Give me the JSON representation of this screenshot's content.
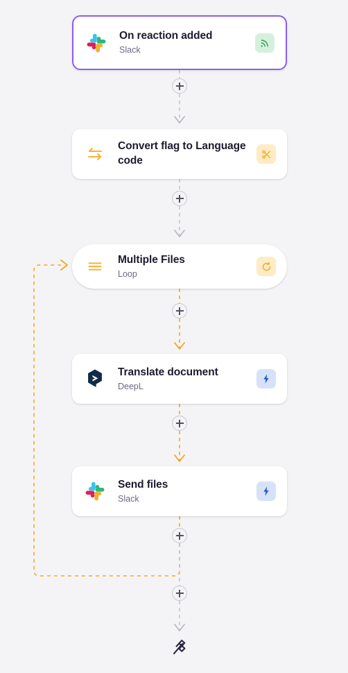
{
  "canvas": {
    "background": "#f4f4f6",
    "accent_selected": "#8b5cf6",
    "accent_loop": "#f5a623",
    "accent_default": "#c8c8d0"
  },
  "workflow": {
    "nodes": [
      {
        "id": "on-reaction-added",
        "title": "On reaction added",
        "subtitle": "Slack",
        "app_icon": "slack-icon",
        "badge_icon": "trigger-feed-icon",
        "badge_color": "#2e9e5b",
        "selected": true,
        "shape": "card"
      },
      {
        "id": "convert-flag-to-language-code",
        "title": "Convert flag to Language code",
        "subtitle": "",
        "app_icon": "swap-arrows-icon",
        "badge_icon": "scissors-icon",
        "badge_color": "#f5a623",
        "selected": false,
        "shape": "card"
      },
      {
        "id": "multiple-files",
        "title": "Multiple Files",
        "subtitle": "Loop",
        "app_icon": "list-lines-icon",
        "badge_icon": "loop-arrow-icon",
        "badge_color": "#f5a623",
        "selected": false,
        "shape": "pill"
      },
      {
        "id": "translate-document",
        "title": "Translate document",
        "subtitle": "DeepL",
        "app_icon": "deepl-icon",
        "badge_icon": "lightning-icon",
        "badge_color": "#2c5bd6",
        "selected": false,
        "shape": "card"
      },
      {
        "id": "send-files",
        "title": "Send files",
        "subtitle": "Slack",
        "app_icon": "slack-icon",
        "badge_icon": "lightning-icon",
        "badge_color": "#2c5bd6",
        "selected": false,
        "shape": "card"
      }
    ],
    "add_buttons": [
      {
        "id": "add-step-1",
        "label": "+"
      },
      {
        "id": "add-step-2",
        "label": "+"
      },
      {
        "id": "add-step-3",
        "label": "+"
      },
      {
        "id": "add-step-4",
        "label": "+"
      },
      {
        "id": "add-step-5",
        "label": "+"
      },
      {
        "id": "add-step-6",
        "label": "+"
      }
    ],
    "end_marker": {
      "id": "workflow-end",
      "icon": "checkered-flag-icon"
    }
  }
}
